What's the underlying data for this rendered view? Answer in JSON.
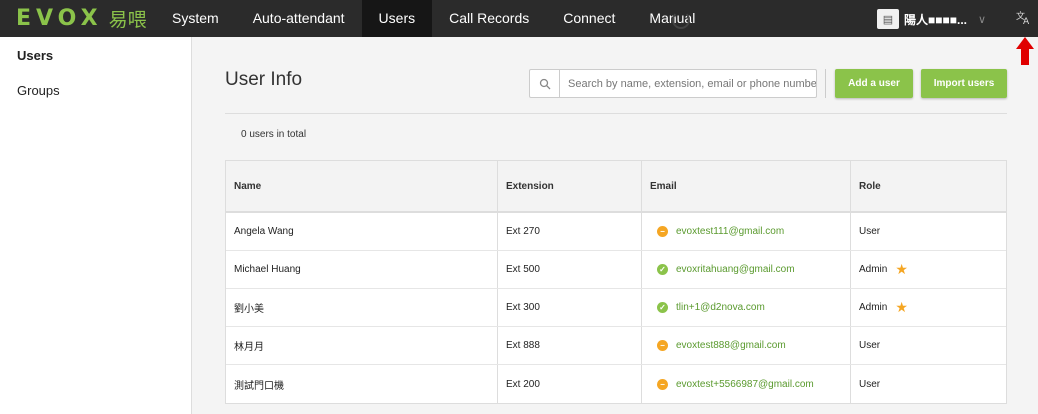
{
  "app": {
    "logo": "EVOX",
    "logo_cn": "易喂"
  },
  "nav": [
    {
      "label": "System"
    },
    {
      "label": "Auto-attendant"
    },
    {
      "label": "Users"
    },
    {
      "label": "Call Records"
    },
    {
      "label": "Connect"
    },
    {
      "label": "Manual"
    }
  ],
  "account": {
    "name": "陽人■■■■..."
  },
  "sidebar": {
    "items": [
      {
        "label": "Users"
      },
      {
        "label": "Groups"
      }
    ]
  },
  "main": {
    "title": "User Info",
    "search_placeholder": "Search by name, extension, email or phone number",
    "add_user": "Add a user",
    "import_users": "Import users",
    "total": "0 users in total"
  },
  "table": {
    "headers": {
      "name": "Name",
      "extension": "Extension",
      "email": "Email",
      "role": "Role"
    },
    "rows": [
      {
        "name": "Angela Wang",
        "extension": "Ext 270",
        "email": "evoxtest111@gmail.com",
        "status": "warn",
        "role": "User",
        "star": false
      },
      {
        "name": "Michael Huang",
        "extension": "Ext 500",
        "email": "evoxritahuang@gmail.com",
        "status": "ok",
        "role": "Admin",
        "star": true
      },
      {
        "name": "劉小美",
        "extension": "Ext 300",
        "email": "tlin+1@d2nova.com",
        "status": "ok",
        "role": "Admin",
        "star": true
      },
      {
        "name": "林月月",
        "extension": "Ext 888",
        "email": "evoxtest888@gmail.com",
        "status": "warn",
        "role": "User",
        "star": false
      },
      {
        "name": "測試門口機",
        "extension": "Ext 200",
        "email": "evoxtest+5566987@gmail.com",
        "status": "warn",
        "role": "User",
        "star": false
      }
    ]
  },
  "colors": {
    "accent": "#8bc34a",
    "topbar": "#2b2b2b",
    "warn": "#f5a623"
  }
}
